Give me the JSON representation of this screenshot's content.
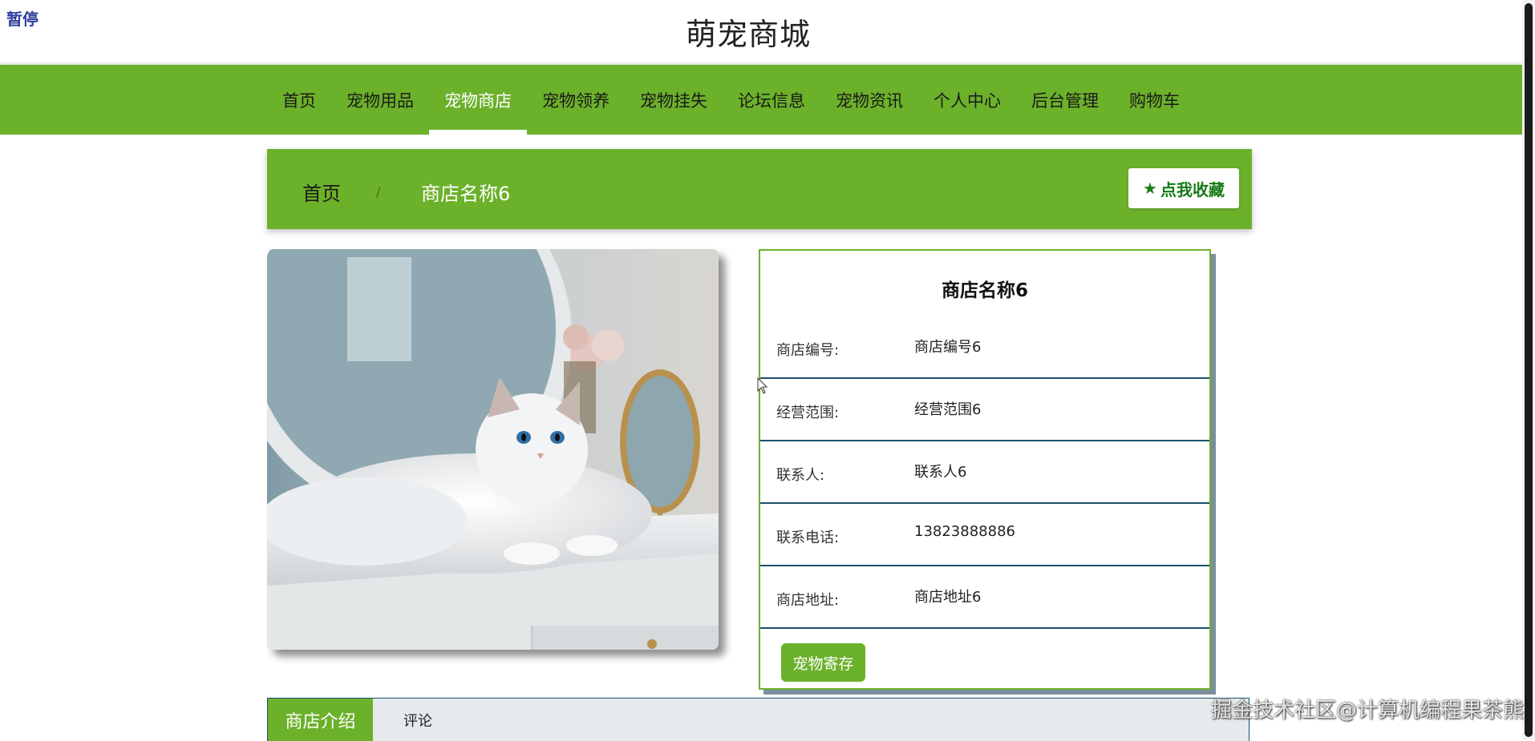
{
  "pause_label": "暂停",
  "site": {
    "title": "萌宠商城"
  },
  "nav": {
    "items": [
      {
        "label": "首页"
      },
      {
        "label": "宠物用品"
      },
      {
        "label": "宠物商店"
      },
      {
        "label": "宠物领养"
      },
      {
        "label": "宠物挂失"
      },
      {
        "label": "论坛信息"
      },
      {
        "label": "宠物资讯"
      },
      {
        "label": "个人中心"
      },
      {
        "label": "后台管理"
      },
      {
        "label": "购物车"
      }
    ],
    "active_label": "宠物商店"
  },
  "breadcrumb": {
    "home": "首页",
    "separator": "/",
    "current": "商店名称6",
    "favorite_label": "点我收藏"
  },
  "shop": {
    "name": "商店名称6",
    "fields": [
      {
        "label": "商店编号:",
        "value": "商店编号6"
      },
      {
        "label": "经营范围:",
        "value": "经营范围6"
      },
      {
        "label": "联系人:",
        "value": "联系人6"
      },
      {
        "label": "联系电话:",
        "value": "13823888886"
      },
      {
        "label": "商店地址:",
        "value": "商店地址6"
      }
    ],
    "deposit_label": "宠物寄存"
  },
  "tabs": [
    {
      "label": "商店介绍",
      "active": true
    },
    {
      "label": "评论",
      "active": false
    }
  ],
  "watermark": "掘金技术社区@计算机编程果茶熊",
  "colors": {
    "brand_green": "#6cb12a",
    "star_green": "#177b17",
    "row_border": "#1d4f6e"
  }
}
